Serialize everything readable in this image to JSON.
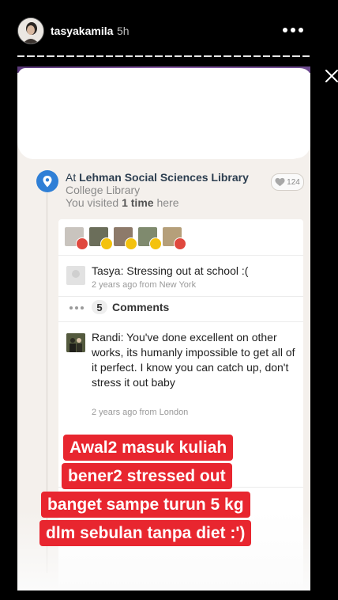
{
  "header": {
    "username": "tasyakamila",
    "time_ago": "5h"
  },
  "location": {
    "at_label": "At",
    "place_name": "Lehman Social Sciences Library",
    "category": "College Library",
    "visited_prefix": "You visited",
    "visited_count": "1 time",
    "visited_suffix": "here",
    "likes": "124"
  },
  "post": {
    "author": "Tasya:",
    "text": "Stressing out at school :(",
    "meta": "2 years ago from New York"
  },
  "comments": {
    "count": "5",
    "label": "Comments",
    "items": [
      {
        "author": "Randi:",
        "text": "You've done excellent on other works, its humanly impossible to get all of it perfect. I know you can catch up, don't stress it out baby",
        "meta": "2 years ago from London"
      }
    ]
  },
  "caption": {
    "lines": [
      "Awal2 masuk kuliah",
      "bener2 stressed out",
      "banget sampe turun 5 kg",
      "dlm sebulan tanpa diet :')"
    ]
  },
  "colors": {
    "caption_bg": "#e8262f",
    "pin_blue": "#2f7fd6",
    "reaction_red": "#e0483e",
    "reaction_yellow": "#f4c20d"
  }
}
